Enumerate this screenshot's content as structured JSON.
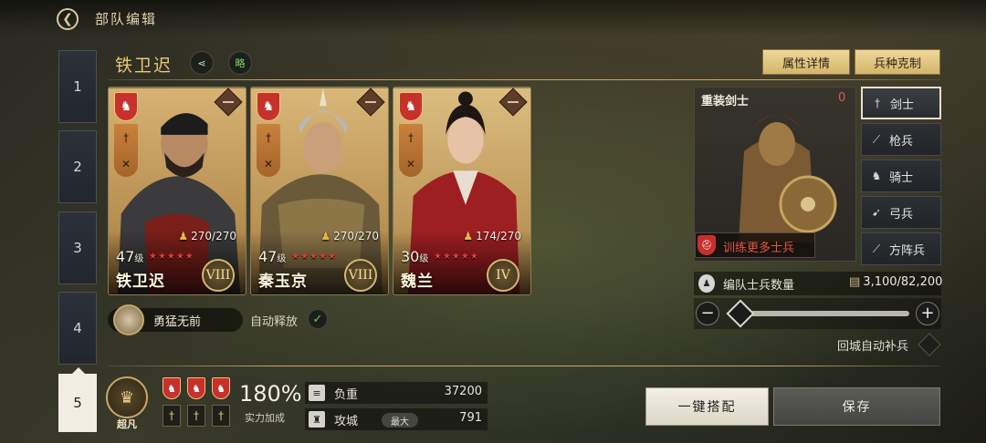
{
  "header": {
    "title": "部队编辑",
    "back_icon": "back-arrow-icon"
  },
  "tabs": [
    {
      "label": "1",
      "active": false
    },
    {
      "label": "2",
      "active": false
    },
    {
      "label": "3",
      "active": false
    },
    {
      "label": "4",
      "active": false
    },
    {
      "label": "5",
      "active": true
    }
  ],
  "squad": {
    "name": "铁卫迟",
    "share_icon": "share-icon",
    "strategy_label": "略",
    "attr_button": "属性详情",
    "counter_button": "兵种克制"
  },
  "heroes": [
    {
      "name": "铁卫迟",
      "level": "47",
      "level_unit": "级",
      "troops": "270/270",
      "tier": "VIII",
      "stars": 5
    },
    {
      "name": "秦玉京",
      "level": "47",
      "level_unit": "级",
      "troops": "270/270",
      "tier": "VIII",
      "stars": 5
    },
    {
      "name": "魏兰",
      "level": "30",
      "level_unit": "级",
      "troops": "174/270",
      "tier": "IV",
      "stars": 5
    }
  ],
  "skill": {
    "name": "勇猛无前",
    "auto_label": "自动释放",
    "auto_enabled": true
  },
  "troop": {
    "name": "重装剑士",
    "count": "0",
    "train_label": "训练更多士兵",
    "units": [
      {
        "label": "剑士",
        "icon": "sword-icon",
        "active": true
      },
      {
        "label": "枪兵",
        "icon": "spear-icon",
        "active": false
      },
      {
        "label": "骑士",
        "icon": "horse-icon",
        "active": false
      },
      {
        "label": "弓兵",
        "icon": "bow-icon",
        "active": false
      },
      {
        "label": "方阵兵",
        "icon": "pike-icon",
        "active": false
      }
    ],
    "count_label": "编队士兵数量",
    "count_value": "3,100/82,200",
    "auto_supply_label": "回城自动补兵"
  },
  "bottom": {
    "rank_label": "超凡",
    "power_value": "180%",
    "power_label": "实力加成",
    "stats": [
      {
        "label": "负重",
        "value": "37200",
        "icon": "load-icon"
      },
      {
        "label": "攻城",
        "value": "791",
        "icon": "siege-icon",
        "tag": "最大"
      }
    ],
    "auto_button": "一键搭配",
    "save_button": "保存"
  },
  "colors": {
    "accent_gold": "#e9c777",
    "shield_red": "#c7312c",
    "warning_red": "#e7543f"
  }
}
